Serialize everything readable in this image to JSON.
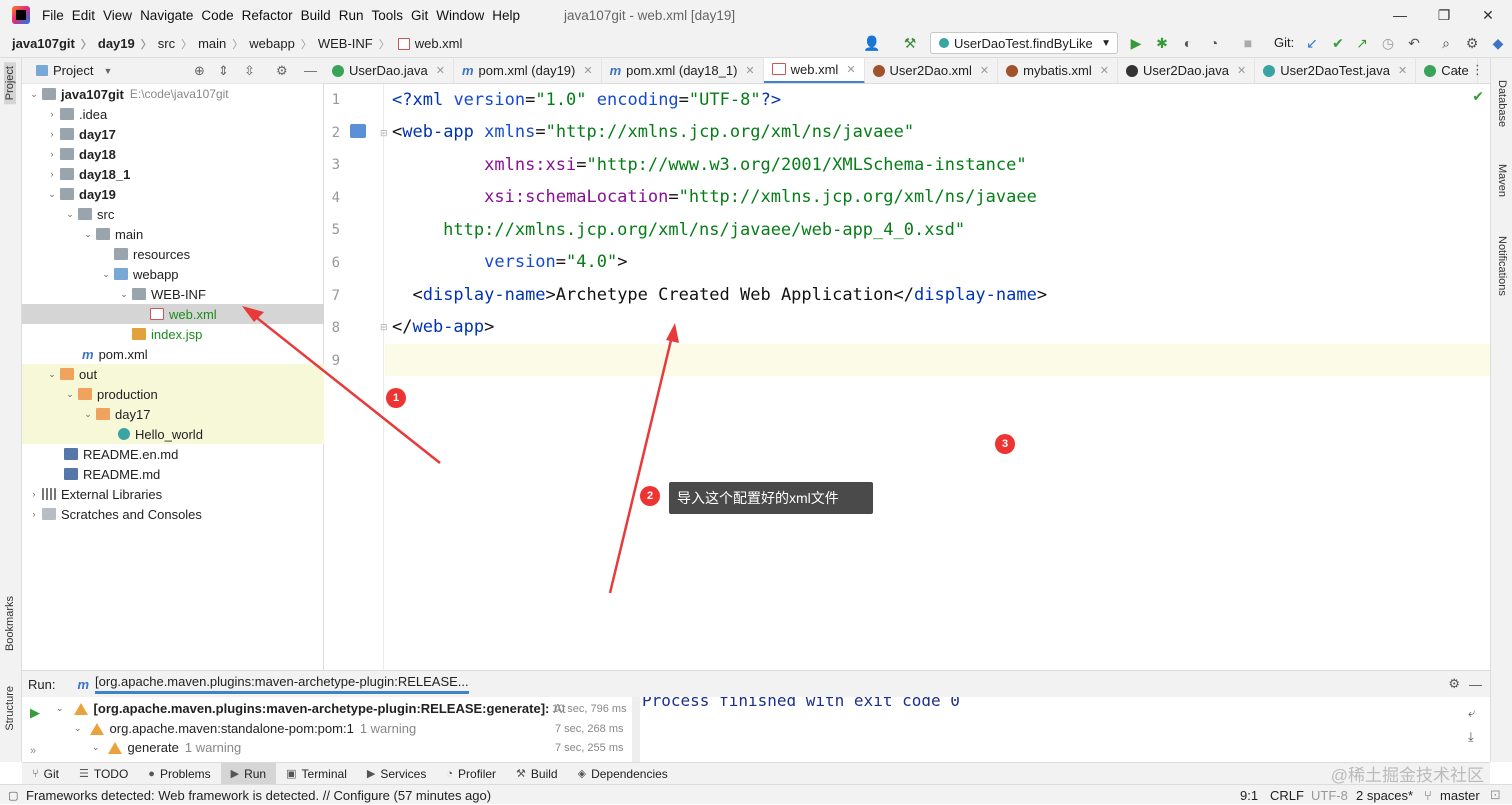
{
  "menubar": {
    "items": [
      "File",
      "Edit",
      "View",
      "Navigate",
      "Code",
      "Refactor",
      "Build",
      "Run",
      "Tools",
      "Git",
      "Window",
      "Help"
    ],
    "window_title": "java107git - web.xml [day19]"
  },
  "breadcrumb": [
    "java107git",
    "day19",
    "src",
    "main",
    "webapp",
    "WEB-INF",
    "web.xml"
  ],
  "toolbar": {
    "run_config": "UserDaoTest.findByLike",
    "git_label": "Git:"
  },
  "project_panel": {
    "title": "Project",
    "tree": [
      {
        "label": "java107git",
        "hint": "E:\\code\\java107git",
        "bold": true
      },
      {
        "label": ".idea"
      },
      {
        "label": "day17",
        "bold": true
      },
      {
        "label": "day18",
        "bold": true
      },
      {
        "label": "day18_1",
        "bold": true
      },
      {
        "label": "day19",
        "bold": true
      },
      {
        "label": "src"
      },
      {
        "label": "main"
      },
      {
        "label": "resources"
      },
      {
        "label": "webapp"
      },
      {
        "label": "WEB-INF"
      },
      {
        "label": "web.xml",
        "green": true,
        "selected": true
      },
      {
        "label": "index.jsp",
        "green": true
      },
      {
        "label": "pom.xml"
      },
      {
        "label": "out"
      },
      {
        "label": "production"
      },
      {
        "label": "day17"
      },
      {
        "label": "Hello_world"
      },
      {
        "label": "README.en.md"
      },
      {
        "label": "README.md"
      },
      {
        "label": "External Libraries"
      },
      {
        "label": "Scratches and Consoles"
      }
    ]
  },
  "tabs": [
    {
      "label": "UserDao.java",
      "color": "#3aa35a"
    },
    {
      "label": "pom.xml (day19)",
      "color": "#3d75c0"
    },
    {
      "label": "pom.xml (day18_1)",
      "color": "#3d75c0"
    },
    {
      "label": "web.xml",
      "color": "#c55",
      "active": true
    },
    {
      "label": "User2Dao.xml",
      "color": "#a0522d"
    },
    {
      "label": "mybatis.xml",
      "color": "#a0522d"
    },
    {
      "label": "User2Dao.java",
      "color": "#333"
    },
    {
      "label": "User2DaoTest.java",
      "color": "#3aa3a3"
    },
    {
      "label": "Cate",
      "color": "#3aa35a"
    }
  ],
  "editor": {
    "line_numbers": [
      "1",
      "2",
      "3",
      "4",
      "5",
      "6",
      "7",
      "8",
      "9"
    ]
  },
  "run_panel": {
    "label": "Run:",
    "tab": "[org.apache.maven.plugins:maven-archetype-plugin:RELEASE...",
    "rows": [
      {
        "text": "[org.apache.maven.plugins:maven-archetype-plugin:RELEASE:generate]:",
        "extra": "At",
        "time": "10 sec, 796 ms"
      },
      {
        "text": "org.apache.maven:standalone-pom:pom:1",
        "extra": "1 warning",
        "time": "7 sec, 268 ms"
      },
      {
        "text": "generate",
        "extra": "1 warning",
        "time": "7 sec, 255 ms"
      }
    ],
    "console": "Process finished with exit code 0"
  },
  "tool_windows": [
    "Git",
    "TODO",
    "Problems",
    "Run",
    "Terminal",
    "Services",
    "Profiler",
    "Build",
    "Dependencies"
  ],
  "status": {
    "message": "Frameworks detected: Web framework is detected. // Configure (57 minutes ago)",
    "position": "9:1",
    "line_sep": "CRLF",
    "encoding": "UTF-8",
    "indent": "2 spaces*",
    "branch": "master"
  },
  "side_labels": {
    "left": [
      "Project",
      "Bookmarks",
      "Structure"
    ],
    "right": [
      "Database",
      "Maven",
      "Notifications"
    ]
  },
  "annotations": {
    "markers": [
      "1",
      "2",
      "3"
    ],
    "tooltip": "导入这个配置好的xml文件"
  },
  "watermark": "@稀土掘金技术社区"
}
